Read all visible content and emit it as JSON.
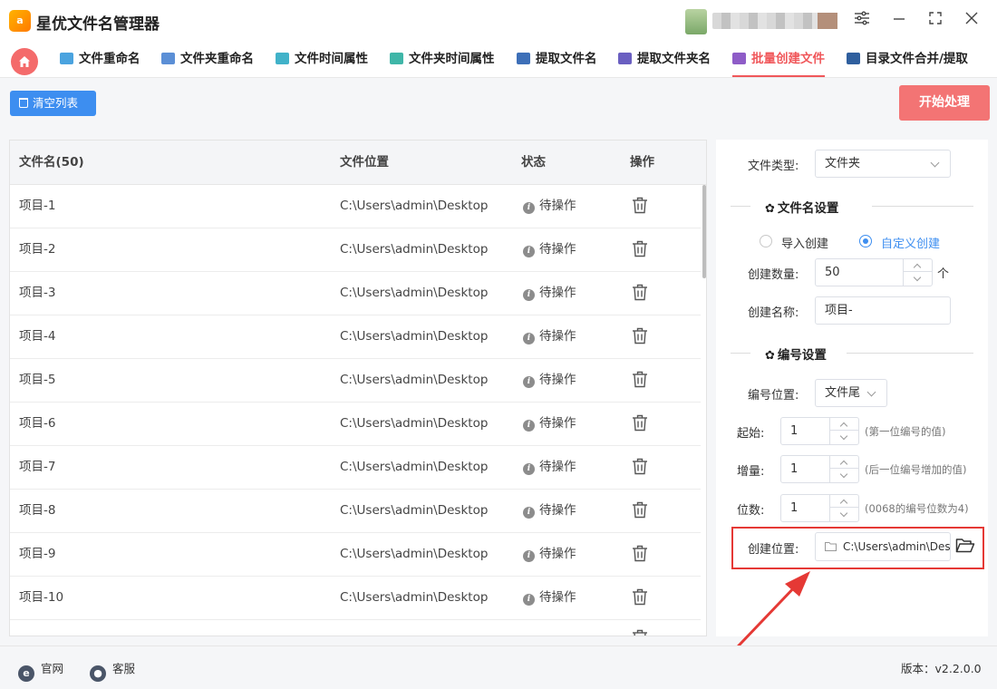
{
  "app": {
    "title": "星优文件名管理器",
    "logo_text": "a"
  },
  "nav": {
    "tabs": [
      {
        "label": "文件重命名",
        "icon": "rename-files-icon",
        "color": "#4aa3df"
      },
      {
        "label": "文件夹重命名",
        "icon": "rename-folders-icon",
        "color": "#5b8fd6"
      },
      {
        "label": "文件时间属性",
        "icon": "file-time-icon",
        "color": "#41b2c9"
      },
      {
        "label": "文件夹时间属性",
        "icon": "folder-time-icon",
        "color": "#3fb6a8"
      },
      {
        "label": "提取文件名",
        "icon": "extract-filename-icon",
        "color": "#3d6fb8"
      },
      {
        "label": "提取文件夹名",
        "icon": "extract-foldername-icon",
        "color": "#6a5fc1"
      },
      {
        "label": "批量创建文件",
        "icon": "batch-create-icon",
        "color": "#8e5cc7",
        "active": true
      },
      {
        "label": "目录文件合并/提取",
        "icon": "merge-extract-icon",
        "color": "#2f5f9e"
      }
    ]
  },
  "toolbar": {
    "clear_label": "清空列表",
    "start_label": "开始处理"
  },
  "table": {
    "headers": {
      "name": "文件名(50)",
      "location": "文件位置",
      "status": "状态",
      "action": "操作"
    },
    "rows": [
      {
        "name": "项目-1",
        "location": "C:\\Users\\admin\\Desktop",
        "status": "待操作"
      },
      {
        "name": "项目-2",
        "location": "C:\\Users\\admin\\Desktop",
        "status": "待操作"
      },
      {
        "name": "项目-3",
        "location": "C:\\Users\\admin\\Desktop",
        "status": "待操作"
      },
      {
        "name": "项目-4",
        "location": "C:\\Users\\admin\\Desktop",
        "status": "待操作"
      },
      {
        "name": "项目-5",
        "location": "C:\\Users\\admin\\Desktop",
        "status": "待操作"
      },
      {
        "name": "项目-6",
        "location": "C:\\Users\\admin\\Desktop",
        "status": "待操作"
      },
      {
        "name": "项目-7",
        "location": "C:\\Users\\admin\\Desktop",
        "status": "待操作"
      },
      {
        "name": "项目-8",
        "location": "C:\\Users\\admin\\Desktop",
        "status": "待操作"
      },
      {
        "name": "项目-9",
        "location": "C:\\Users\\admin\\Desktop",
        "status": "待操作"
      },
      {
        "name": "项目-10",
        "location": "C:\\Users\\admin\\Desktop",
        "status": "待操作"
      }
    ]
  },
  "settings": {
    "file_type": {
      "label": "文件类型:",
      "value": "文件夹"
    },
    "name_section": {
      "title": "文件名设置"
    },
    "mode": {
      "option_import": "导入创建",
      "option_custom": "自定义创建",
      "selected": "自定义创建"
    },
    "count": {
      "label": "创建数量:",
      "value": "50",
      "unit": "个"
    },
    "name": {
      "label": "创建名称:",
      "value": "项目-"
    },
    "number_section": {
      "title": "编号设置"
    },
    "number_position": {
      "label": "编号位置:",
      "value": "文件尾"
    },
    "start": {
      "label": "起始:",
      "value": "1",
      "hint": "(第一位编号的值)"
    },
    "step": {
      "label": "增量:",
      "value": "1",
      "hint": "(后一位编号增加的值)"
    },
    "digits": {
      "label": "位数:",
      "value": "1",
      "hint": "(0068的编号位数为4)"
    },
    "location": {
      "label": "创建位置:",
      "value": "C:\\Users\\admin\\Des"
    }
  },
  "footer": {
    "website": "官网",
    "service": "客服",
    "version": "版本：v2.2.0.0"
  },
  "colors": {
    "accent": "#f0575a",
    "primary": "#3d8ef0",
    "start_button": "#f37474",
    "highlight": "#e53935"
  }
}
